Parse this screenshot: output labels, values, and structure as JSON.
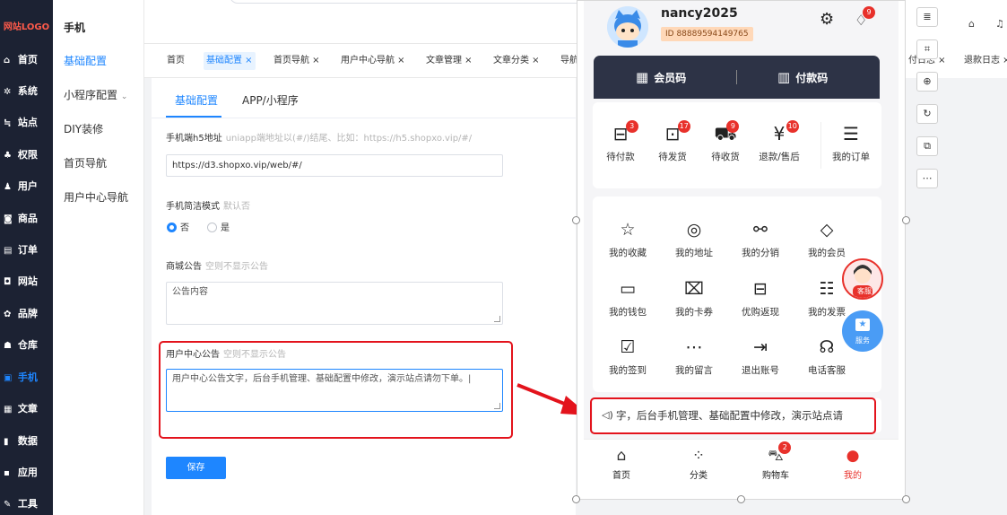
{
  "sidebar": {
    "logo": "网站LOGO",
    "items": [
      {
        "icon": "home-icon",
        "glyph": "⌂",
        "label": "首页"
      },
      {
        "icon": "gear-icon",
        "glyph": "✲",
        "label": "系统"
      },
      {
        "icon": "site-icon",
        "glyph": "≒",
        "label": "站点"
      },
      {
        "icon": "permission-icon",
        "glyph": "♣",
        "label": "权限"
      },
      {
        "icon": "user-icon",
        "glyph": "♟",
        "label": "用户"
      },
      {
        "icon": "goods-icon",
        "glyph": "◙",
        "label": "商品"
      },
      {
        "icon": "order-icon",
        "glyph": "▤",
        "label": "订单"
      },
      {
        "icon": "website-icon",
        "glyph": "◘",
        "label": "网站"
      },
      {
        "icon": "brand-icon",
        "glyph": "✿",
        "label": "品牌"
      },
      {
        "icon": "warehouse-icon",
        "glyph": "☗",
        "label": "仓库"
      },
      {
        "icon": "mobile-icon",
        "glyph": "▣",
        "label": "手机"
      },
      {
        "icon": "article-icon",
        "glyph": "▦",
        "label": "文章"
      },
      {
        "icon": "data-icon",
        "glyph": "▮",
        "label": "数据"
      },
      {
        "icon": "apps-icon",
        "glyph": "▪",
        "label": "应用"
      },
      {
        "icon": "tools-icon",
        "glyph": "✎",
        "label": "工具"
      }
    ]
  },
  "subnav": {
    "title": "手机",
    "items": [
      "基础配置",
      "小程序配置",
      "DIY装修",
      "首页导航",
      "用户中心导航"
    ]
  },
  "tabs": [
    "首页",
    "基础配置 ×",
    "首页导航 ×",
    "用户中心导航 ×",
    "文章管理 ×",
    "文章分类 ×",
    "导航",
    "付日志 ×",
    "退款日志 ×"
  ],
  "content": {
    "tabs": [
      "基础配置",
      "APP/小程序"
    ],
    "fields": {
      "h5_label": "手机端h5地址",
      "h5_hint": "uniapp端地址以(#/)结尾、比如：https://h5.shopxo.vip/#/",
      "h5_value": "https://d3.shopxo.vip/web/#/",
      "simple_label": "手机简洁模式",
      "simple_hint": "默认否",
      "radio_no": "否",
      "radio_yes": "是",
      "notice_label": "商城公告",
      "notice_hint": "空则不显示公告",
      "notice_value": "公告内容",
      "center_label": "用户中心公告",
      "center_hint": "空则不显示公告",
      "center_value": "用户中心公告文字，后台手机管理、基础配置中修改，演示站点请勿下单。"
    },
    "save_label": "保存"
  },
  "phone": {
    "username": "nancy2025",
    "user_id": "ID 88889594149765",
    "bell_badge": "9",
    "member_code": "会员码",
    "pay_code": "付款码",
    "orders": [
      {
        "icon": "wallet-pay-icon",
        "glyph": "⊟",
        "label": "待付款",
        "badge": "3"
      },
      {
        "icon": "ship-icon",
        "glyph": "⊡",
        "label": "待发货",
        "badge": "17"
      },
      {
        "icon": "truck-icon",
        "glyph": "⛟",
        "label": "待收货",
        "badge": "9"
      },
      {
        "icon": "refund-icon",
        "glyph": "¥",
        "label": "退款/售后",
        "badge": "10"
      },
      {
        "icon": "order-list-icon",
        "glyph": "☰",
        "label": "我的订单",
        "badge": ""
      }
    ],
    "services": [
      {
        "icon": "star-icon",
        "glyph": "☆",
        "label": "我的收藏"
      },
      {
        "icon": "location-icon",
        "glyph": "◎",
        "label": "我的地址"
      },
      {
        "icon": "share-icon",
        "glyph": "⚯",
        "label": "我的分销"
      },
      {
        "icon": "diamond-icon",
        "glyph": "◇",
        "label": "我的会员"
      },
      {
        "icon": "wallet-icon",
        "glyph": "▭",
        "label": "我的钱包"
      },
      {
        "icon": "coupon-icon",
        "glyph": "⌧",
        "label": "我的卡券"
      },
      {
        "icon": "cashback-icon",
        "glyph": "⊟",
        "label": "优购返现"
      },
      {
        "icon": "invoice-icon",
        "glyph": "☷",
        "label": "我的发票"
      },
      {
        "icon": "checkin-icon",
        "glyph": "☑",
        "label": "我的签到"
      },
      {
        "icon": "message-icon",
        "glyph": "⋯",
        "label": "我的留言"
      },
      {
        "icon": "logout-icon",
        "glyph": "⇥",
        "label": "退出账号"
      },
      {
        "icon": "headset-icon",
        "glyph": "☊",
        "label": "电话客服"
      }
    ],
    "marquee": "字，后台手机管理、基础配置中修改，演示站点请",
    "float_cs": "客服",
    "float_svc": "服务",
    "tabbar": [
      {
        "icon": "home-icon",
        "glyph": "⌂",
        "label": "首页"
      },
      {
        "icon": "category-icon",
        "glyph": "⁘",
        "label": "分类"
      },
      {
        "icon": "cart-icon",
        "glyph": "⛍",
        "label": "购物车",
        "badge": "2"
      },
      {
        "icon": "profile-icon",
        "glyph": "●",
        "label": "我的"
      }
    ]
  },
  "colors": {
    "accent": "#1e86ff",
    "sidebar_bg": "#1c2233",
    "highlight_red": "#e3131c",
    "badge_red": "#e8312b"
  }
}
